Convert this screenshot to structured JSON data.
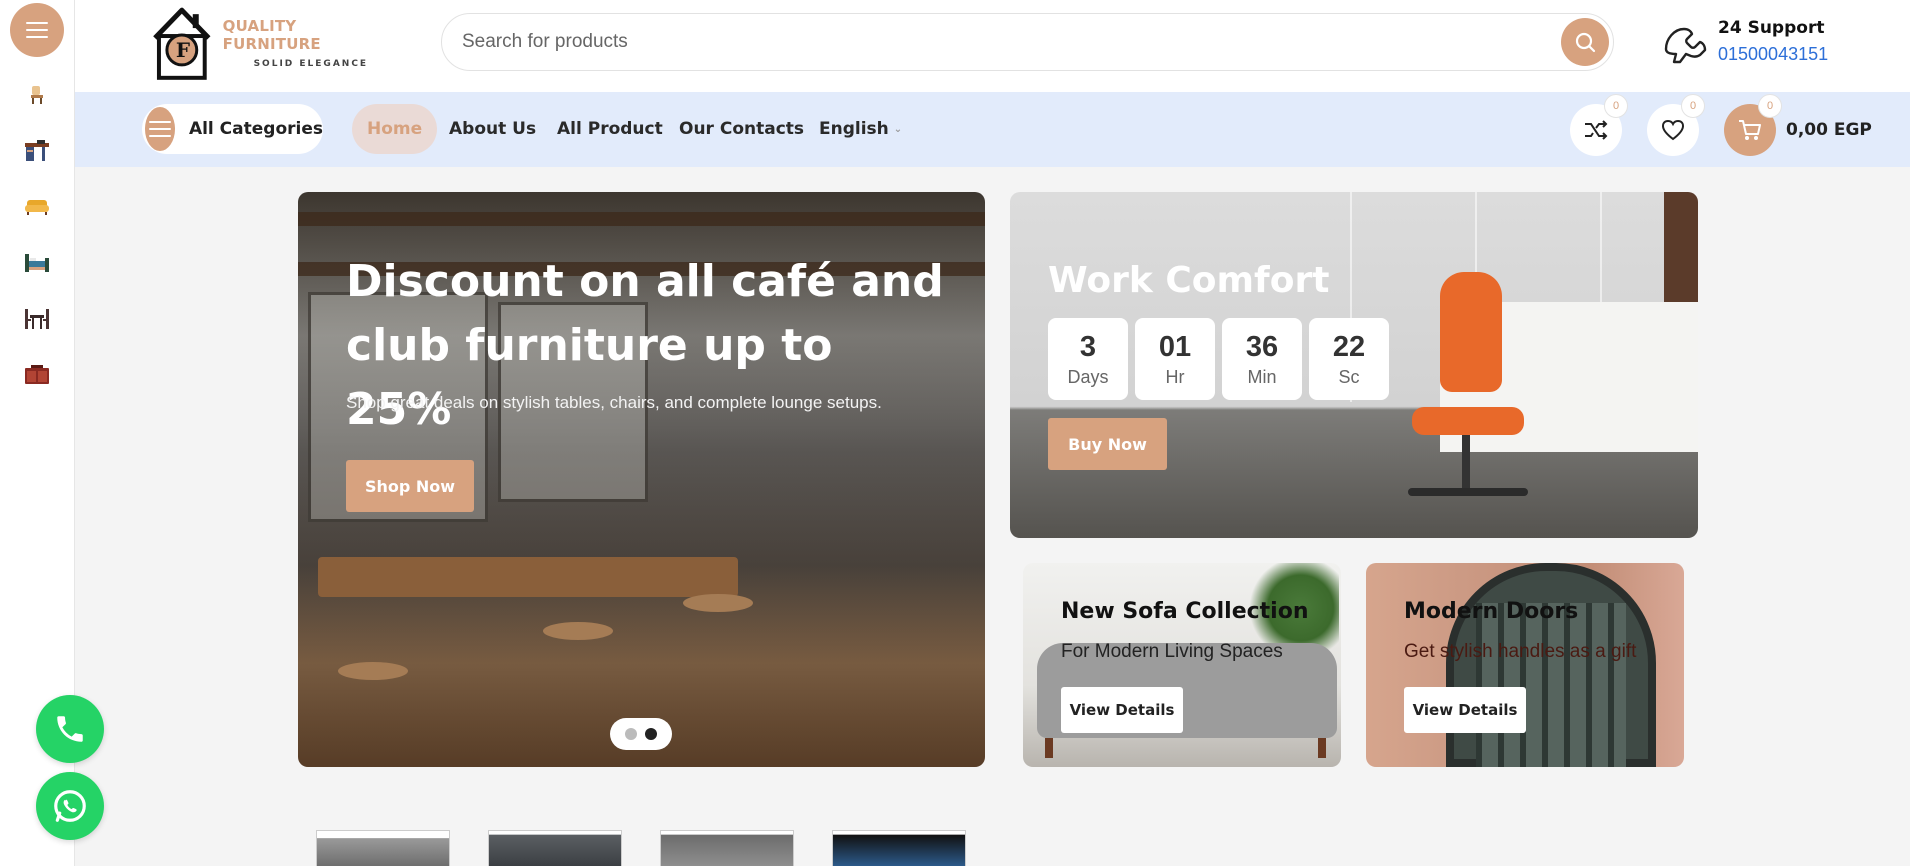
{
  "header": {
    "logo": {
      "title": "QUALITY FURNITURE",
      "subtitle": "SOLID ELEGANCE",
      "monogram": "F"
    },
    "search": {
      "placeholder": "Search for products"
    },
    "support": {
      "title": "24 Support",
      "phone": "01500043151"
    }
  },
  "rail": {
    "menu_icon": "hamburger-icon",
    "categories": [
      "chair-icon",
      "desk-icon",
      "sofa-icon",
      "bed-icon",
      "dining-icon",
      "cabinet-icon"
    ],
    "floating": [
      "phone-icon",
      "whatsapp-icon"
    ]
  },
  "nav": {
    "all_categories": "All Categories",
    "items": [
      "Home",
      "About Us",
      "All Product",
      "Our Contacts",
      "English"
    ],
    "active": "Home",
    "compare_count": "0",
    "wishlist_count": "0",
    "cart_count": "0",
    "cart_total": "0,00 EGP"
  },
  "hero": {
    "title": "Discount on all café and club furniture up to 25%",
    "description": "Shop great deals on stylish tables, chairs, and complete lounge setups.",
    "button": "Shop Now",
    "slides": 2,
    "active_slide": 2
  },
  "work": {
    "title": "Work Comfort",
    "countdown": [
      {
        "value": "3",
        "unit": "Days"
      },
      {
        "value": "01",
        "unit": "Hr"
      },
      {
        "value": "36",
        "unit": "Min"
      },
      {
        "value": "22",
        "unit": "Sc"
      }
    ],
    "button": "Buy Now"
  },
  "cards": [
    {
      "title": "New Sofa Collection",
      "subtitle": "For Modern Living Spaces",
      "button": "View Details"
    },
    {
      "title": "Modern Doors",
      "subtitle": "Get stylish handles as a gift",
      "button": "View Details"
    }
  ],
  "colors": {
    "accent": "#d7a27f",
    "navbar": "#e2ebfb",
    "whatsapp": "#25d366",
    "link": "#2d6fd8"
  }
}
